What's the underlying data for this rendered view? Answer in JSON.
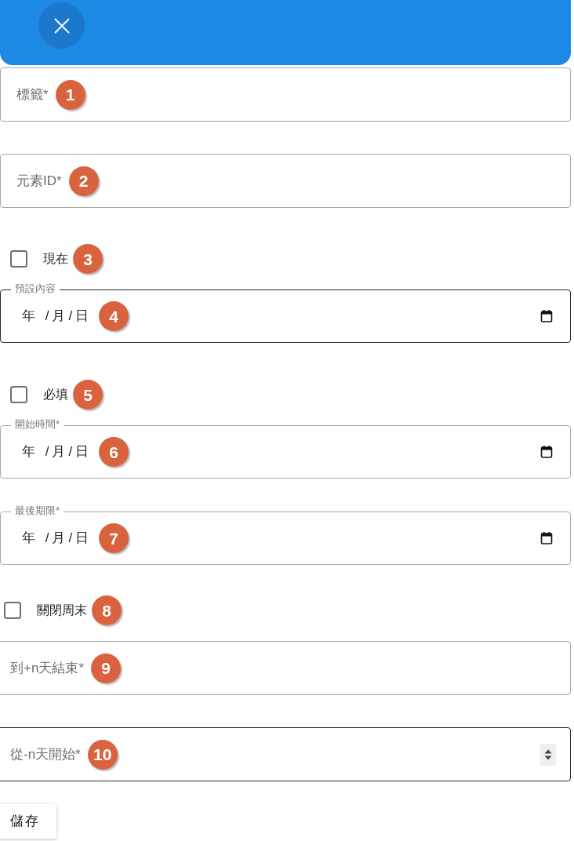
{
  "sections": [
    {
      "fields": [
        {
          "kind": "text",
          "placeholder": "標籤*",
          "marker": "1",
          "focused": false
        },
        {
          "kind": "text",
          "placeholder": "元素ID*",
          "marker": "2",
          "focused": false
        },
        {
          "kind": "checkbox",
          "label": "現在",
          "checked": false,
          "marker": "3"
        },
        {
          "kind": "date",
          "label": "預設內容",
          "placeholder": "年 /月/日",
          "marker": "4",
          "focused": true
        },
        {
          "kind": "checkbox",
          "label": "必填",
          "checked": false,
          "marker": "5"
        },
        {
          "kind": "date",
          "label": "開始時間*",
          "placeholder": "年 /月/日",
          "marker": "6",
          "focused": false
        },
        {
          "kind": "date",
          "label": "最後期限*",
          "placeholder": "年 /月/日",
          "marker": "7",
          "focused": false
        }
      ]
    },
    {
      "fields": [
        {
          "kind": "checkbox",
          "label": "關閉周末",
          "checked": false,
          "marker": "8"
        },
        {
          "kind": "text",
          "placeholder": "到+n天結束*",
          "marker": "9",
          "focused": false
        },
        {
          "kind": "number",
          "placeholder": "從-n天開始*",
          "marker": "10",
          "focused": true
        }
      ]
    }
  ],
  "save_button": {
    "label": "儲存"
  }
}
